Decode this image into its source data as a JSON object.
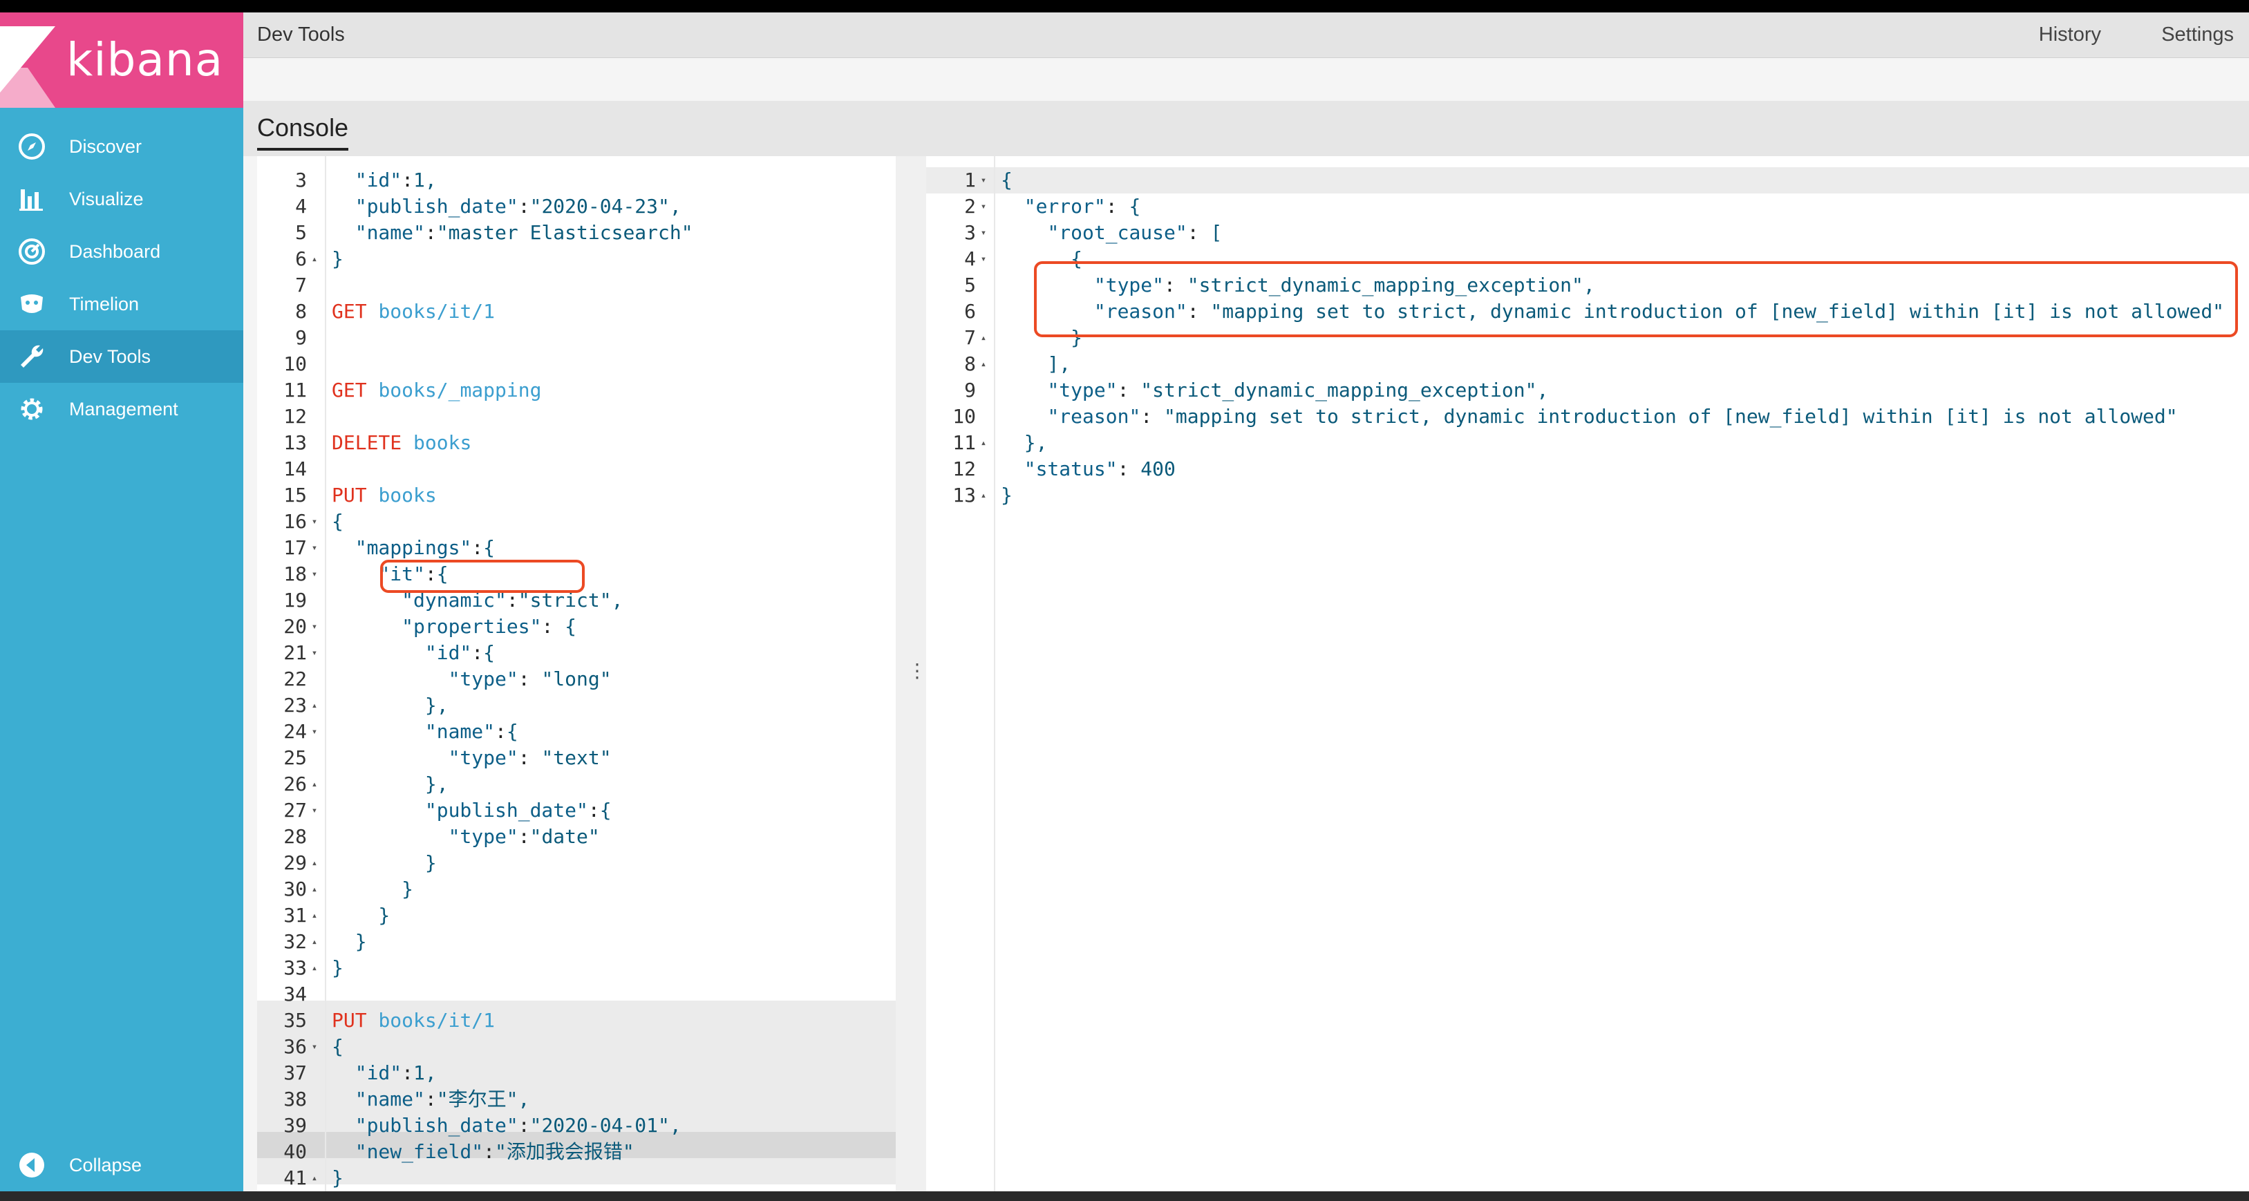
{
  "app": {
    "brand": "kibana",
    "page_title": "Dev Tools"
  },
  "header": {
    "history": "History",
    "settings": "Settings"
  },
  "console_tab": "Console",
  "sidebar": {
    "items": [
      {
        "label": "Discover",
        "icon": "compass-icon"
      },
      {
        "label": "Visualize",
        "icon": "bar-chart-icon"
      },
      {
        "label": "Dashboard",
        "icon": "dashboard-gauge-icon"
      },
      {
        "label": "Timelion",
        "icon": "timelion-mask-icon"
      },
      {
        "label": "Dev Tools",
        "icon": "wrench-icon",
        "active": true
      },
      {
        "label": "Management",
        "icon": "gear-icon"
      }
    ],
    "collapse": "Collapse"
  },
  "colors": {
    "sidebar": "#3caed2",
    "logo_bg": "#e8488b",
    "highlight_box": "#ec4a24",
    "method": "#e0321e",
    "url": "#3b9ecf"
  },
  "request_editor": {
    "lines": [
      {
        "n": "3",
        "f": "",
        "t": "  \"id\":1,"
      },
      {
        "n": "4",
        "f": "",
        "t": "  \"publish_date\":\"2020-04-23\","
      },
      {
        "n": "5",
        "f": "",
        "t": "  \"name\":\"master Elasticsearch\""
      },
      {
        "n": "6",
        "f": "▴",
        "t": "}"
      },
      {
        "n": "7",
        "f": "",
        "t": ""
      },
      {
        "n": "8",
        "f": "",
        "t": "GET books/it/1"
      },
      {
        "n": "9",
        "f": "",
        "t": ""
      },
      {
        "n": "10",
        "f": "",
        "t": ""
      },
      {
        "n": "11",
        "f": "",
        "t": "GET books/_mapping"
      },
      {
        "n": "12",
        "f": "",
        "t": ""
      },
      {
        "n": "13",
        "f": "",
        "t": "DELETE books"
      },
      {
        "n": "14",
        "f": "",
        "t": ""
      },
      {
        "n": "15",
        "f": "",
        "t": "PUT books"
      },
      {
        "n": "16",
        "f": "▾",
        "t": "{"
      },
      {
        "n": "17",
        "f": "▾",
        "t": "  \"mappings\":{"
      },
      {
        "n": "18",
        "f": "▾",
        "t": "    \"it\":{"
      },
      {
        "n": "19",
        "f": "",
        "t": "      \"dynamic\":\"strict\","
      },
      {
        "n": "20",
        "f": "▾",
        "t": "      \"properties\": {"
      },
      {
        "n": "21",
        "f": "▾",
        "t": "        \"id\":{"
      },
      {
        "n": "22",
        "f": "",
        "t": "          \"type\": \"long\""
      },
      {
        "n": "23",
        "f": "▴",
        "t": "        },"
      },
      {
        "n": "24",
        "f": "▾",
        "t": "        \"name\":{"
      },
      {
        "n": "25",
        "f": "",
        "t": "          \"type\": \"text\""
      },
      {
        "n": "26",
        "f": "▴",
        "t": "        },"
      },
      {
        "n": "27",
        "f": "▾",
        "t": "        \"publish_date\":{"
      },
      {
        "n": "28",
        "f": "",
        "t": "          \"type\":\"date\""
      },
      {
        "n": "29",
        "f": "▴",
        "t": "        }"
      },
      {
        "n": "30",
        "f": "▴",
        "t": "      }"
      },
      {
        "n": "31",
        "f": "▴",
        "t": "    }"
      },
      {
        "n": "32",
        "f": "▴",
        "t": "  }"
      },
      {
        "n": "33",
        "f": "▴",
        "t": "}"
      },
      {
        "n": "34",
        "f": "",
        "t": ""
      },
      {
        "n": "35",
        "f": "",
        "t": "PUT books/it/1"
      },
      {
        "n": "36",
        "f": "▾",
        "t": "{"
      },
      {
        "n": "37",
        "f": "",
        "t": "  \"id\":1,"
      },
      {
        "n": "38",
        "f": "",
        "t": "  \"name\":\"李尔王\","
      },
      {
        "n": "39",
        "f": "",
        "t": "  \"publish_date\":\"2020-04-01\","
      },
      {
        "n": "40",
        "f": "",
        "t": "  \"new_field\":\"添加我会报错\""
      },
      {
        "n": "41",
        "f": "▴",
        "t": "}"
      }
    ]
  },
  "response_editor": {
    "lines": [
      {
        "n": "1",
        "f": "▾",
        "t": "{"
      },
      {
        "n": "2",
        "f": "▾",
        "t": "  \"error\": {"
      },
      {
        "n": "3",
        "f": "▾",
        "t": "    \"root_cause\": ["
      },
      {
        "n": "4",
        "f": "▾",
        "t": "      {"
      },
      {
        "n": "5",
        "f": "",
        "t": "        \"type\": \"strict_dynamic_mapping_exception\","
      },
      {
        "n": "6",
        "f": "",
        "t": "        \"reason\": \"mapping set to strict, dynamic introduction of [new_field] within [it] is not allowed\""
      },
      {
        "n": "7",
        "f": "▴",
        "t": "      }"
      },
      {
        "n": "8",
        "f": "▴",
        "t": "    ],"
      },
      {
        "n": "9",
        "f": "",
        "t": "    \"type\": \"strict_dynamic_mapping_exception\","
      },
      {
        "n": "10",
        "f": "",
        "t": "    \"reason\": \"mapping set to strict, dynamic introduction of [new_field] within [it] is not allowed\""
      },
      {
        "n": "11",
        "f": "▴",
        "t": "  },"
      },
      {
        "n": "12",
        "f": "",
        "t": "  \"status\": 400"
      },
      {
        "n": "13",
        "f": "▴",
        "t": "}"
      }
    ]
  }
}
